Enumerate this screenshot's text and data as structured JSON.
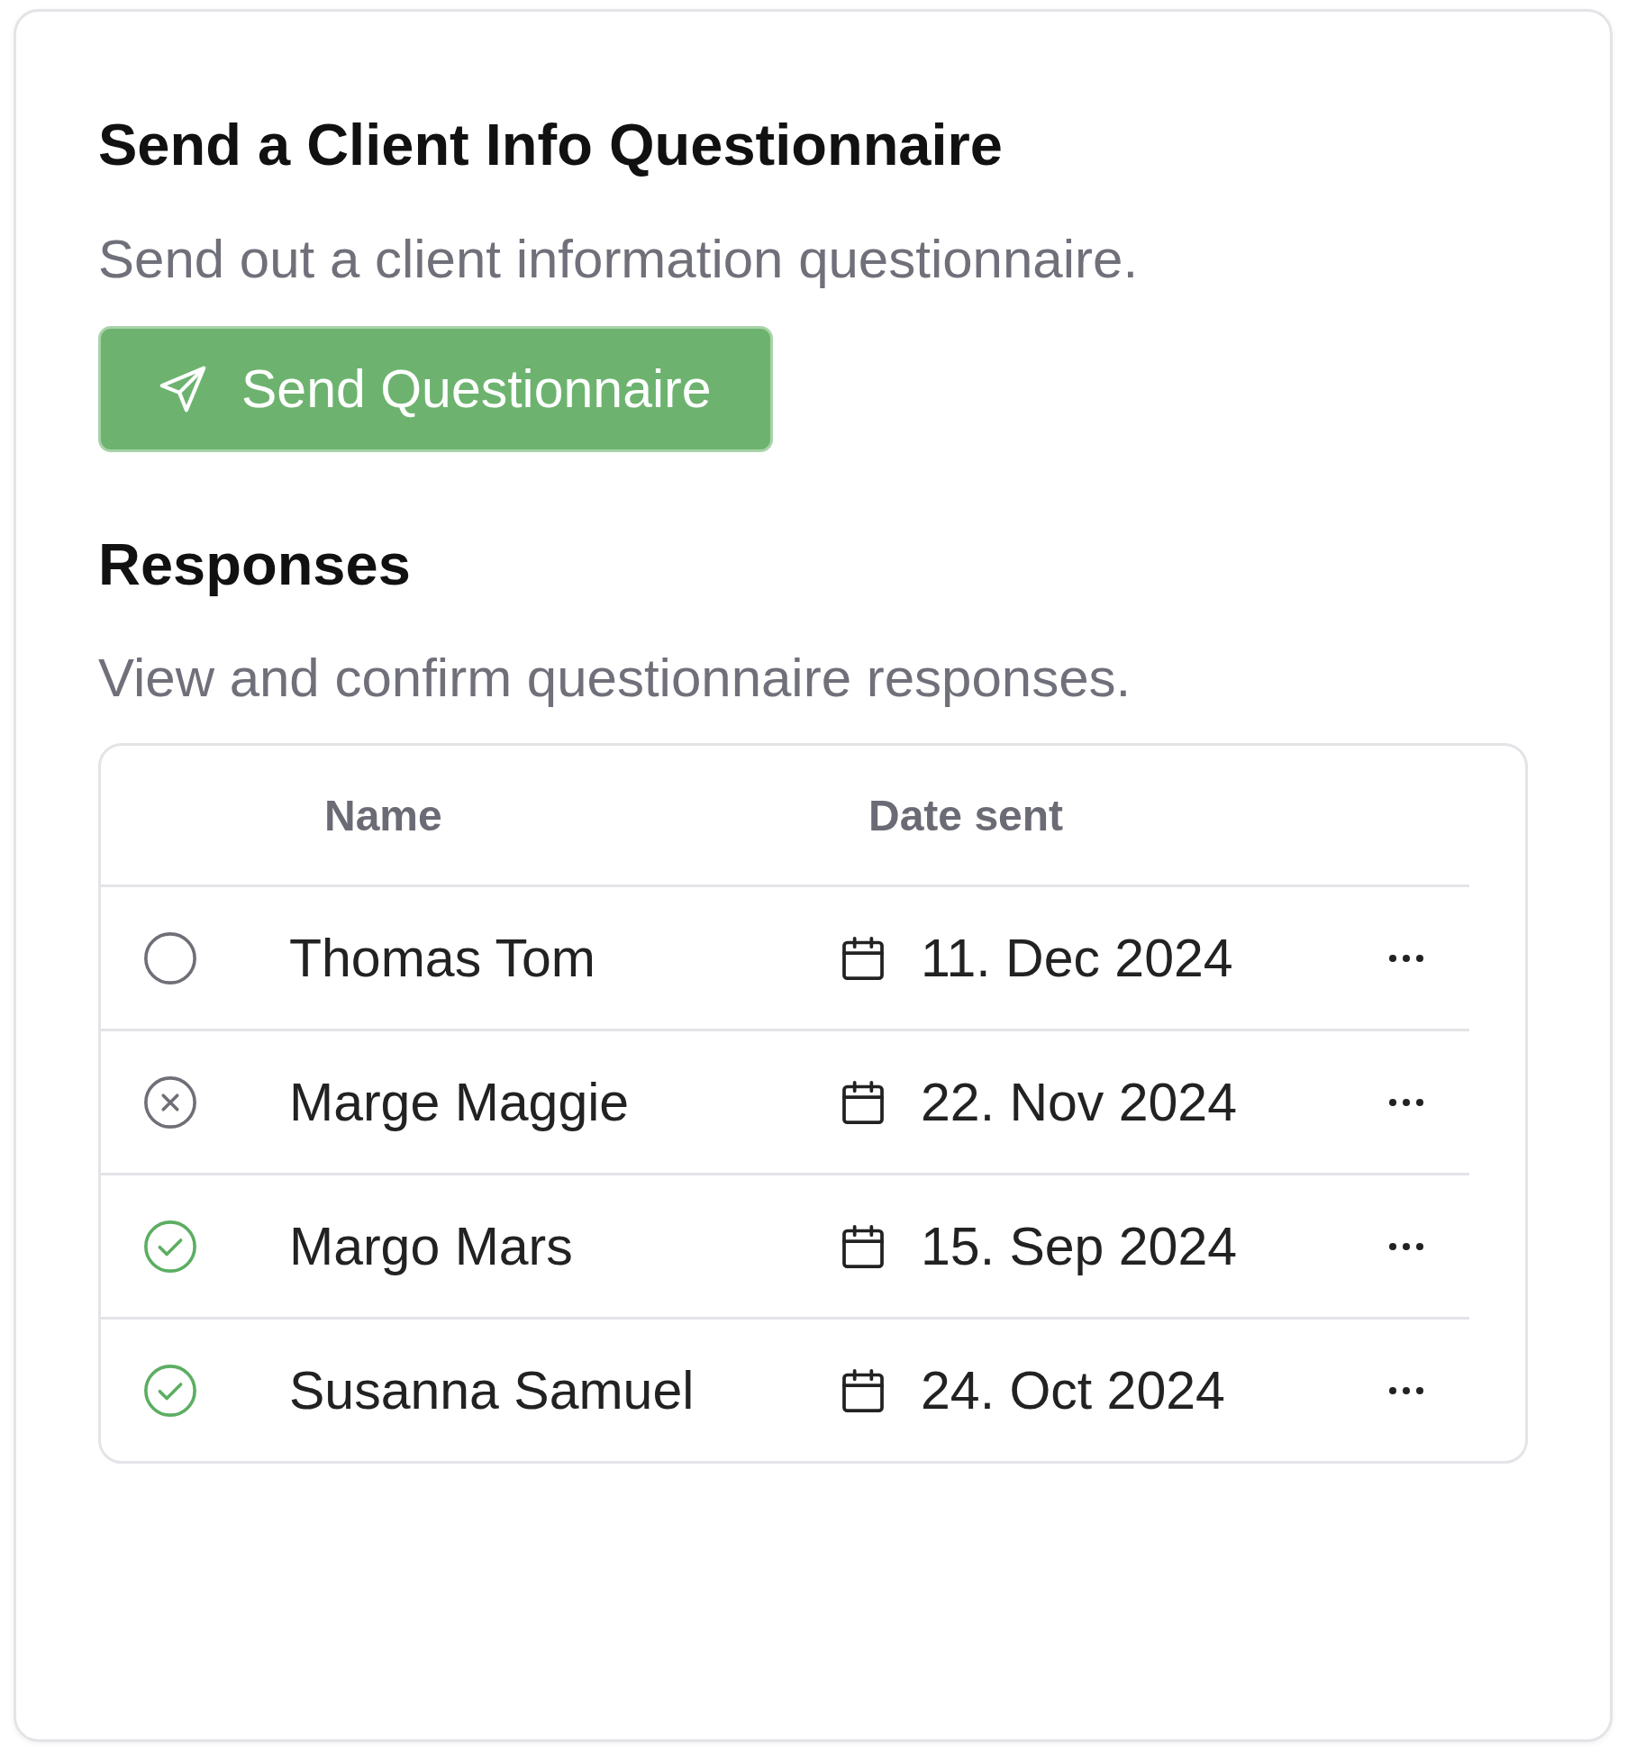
{
  "title": "Send a Client Info Questionnaire",
  "description": "Send out a client information questionnaire.",
  "send_button": {
    "label": "Send Questionnaire"
  },
  "responses": {
    "title": "Responses",
    "description": "View and confirm questionnaire responses.",
    "table": {
      "columns": [
        "Name",
        "Date sent"
      ],
      "rows": [
        {
          "kind": "pending",
          "name": "Thomas Tom",
          "date": "11. Dec 2024"
        },
        {
          "kind": "declined",
          "name": "Marge Maggie",
          "date": "22. Nov 2024"
        },
        {
          "kind": "confirmed",
          "name": "Margo Mars",
          "date": "15. Sep 2024"
        },
        {
          "kind": "confirmed",
          "name": "Susanna Samuel",
          "date": "24. Oct 2024"
        }
      ]
    }
  }
}
